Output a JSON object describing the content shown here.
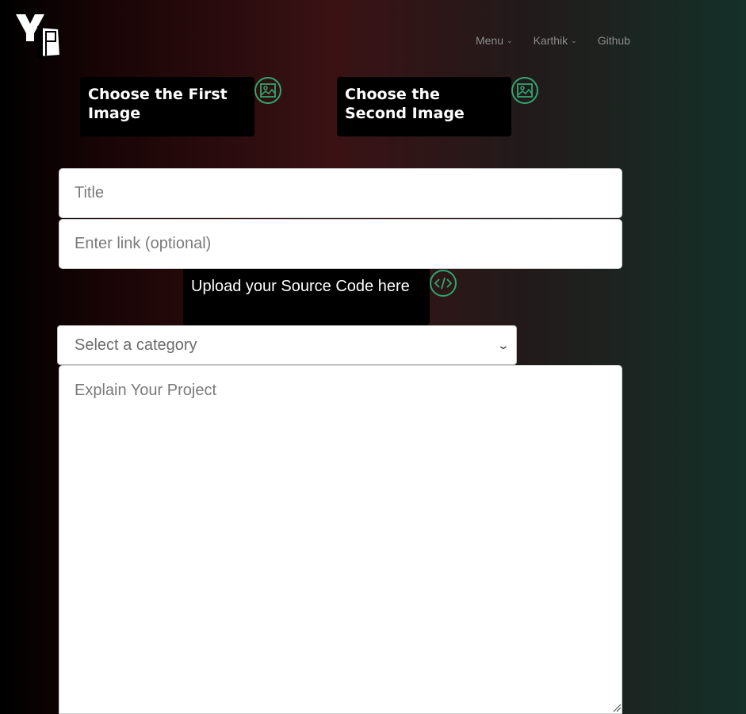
{
  "brand": {
    "logo_text": "YP",
    "logo_icon": "yp-logo"
  },
  "nav": {
    "items": [
      {
        "label": "Menu",
        "has_dropdown": true
      },
      {
        "label": "Karthik",
        "has_dropdown": true
      },
      {
        "label": "Github",
        "has_dropdown": false
      }
    ],
    "caret_glyph": "⌄"
  },
  "images": {
    "first_label": "Choose the First Image",
    "second_label": "Choose the Second Image",
    "icon": "image-icon"
  },
  "form": {
    "title_placeholder": "Title",
    "link_placeholder": "Enter link (optional)",
    "upload_label": "Upload your Source Code here",
    "upload_icon": "code-icon",
    "category_placeholder": "Select a category",
    "description_placeholder": "Explain Your Project"
  },
  "colors": {
    "accent": "#2fa56f",
    "button_bg": "#000000",
    "nav_text": "#8d8d8d"
  }
}
